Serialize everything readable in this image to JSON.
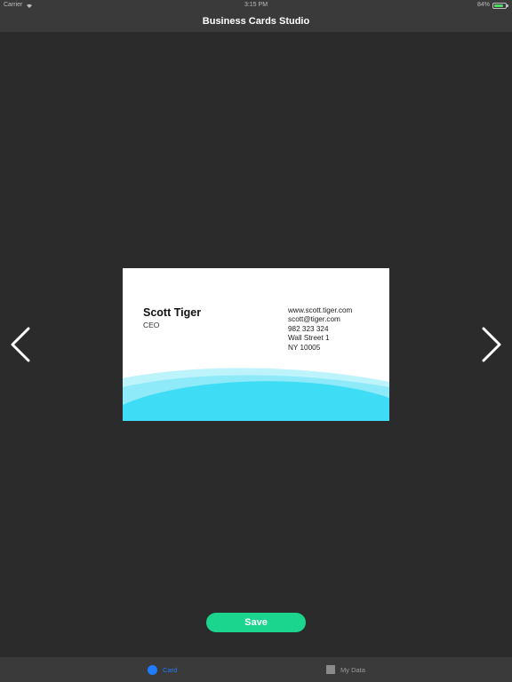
{
  "status_bar": {
    "carrier": "Carrier",
    "time": "3:15 PM",
    "battery": "84%",
    "icons": [
      "wifi-icon",
      "battery-icon"
    ]
  },
  "nav": {
    "title": "Business Cards Studio"
  },
  "card": {
    "name": "Scott Tiger",
    "title": "CEO",
    "contact": {
      "website": "www.scott.tiger.com",
      "email": "scott@tiger.com",
      "phone": "982 323 324",
      "street": "Wall Street 1",
      "city": "NY 10005"
    },
    "wave_colors": [
      "#bdf3fb",
      "#8ee9f8",
      "#3fdcf6"
    ]
  },
  "navigation": {
    "prev_icon": "chevron-left-icon",
    "next_icon": "chevron-right-icon"
  },
  "actions": {
    "save_label": "Save",
    "save_color": "#1bd48e"
  },
  "tab_bar": {
    "tabs": [
      {
        "label": "Card",
        "icon": "circle-icon",
        "active": true,
        "color": "#1e7cff"
      },
      {
        "label": "My Data",
        "icon": "square-icon",
        "active": false,
        "color": "#9a9a9a"
      }
    ]
  }
}
